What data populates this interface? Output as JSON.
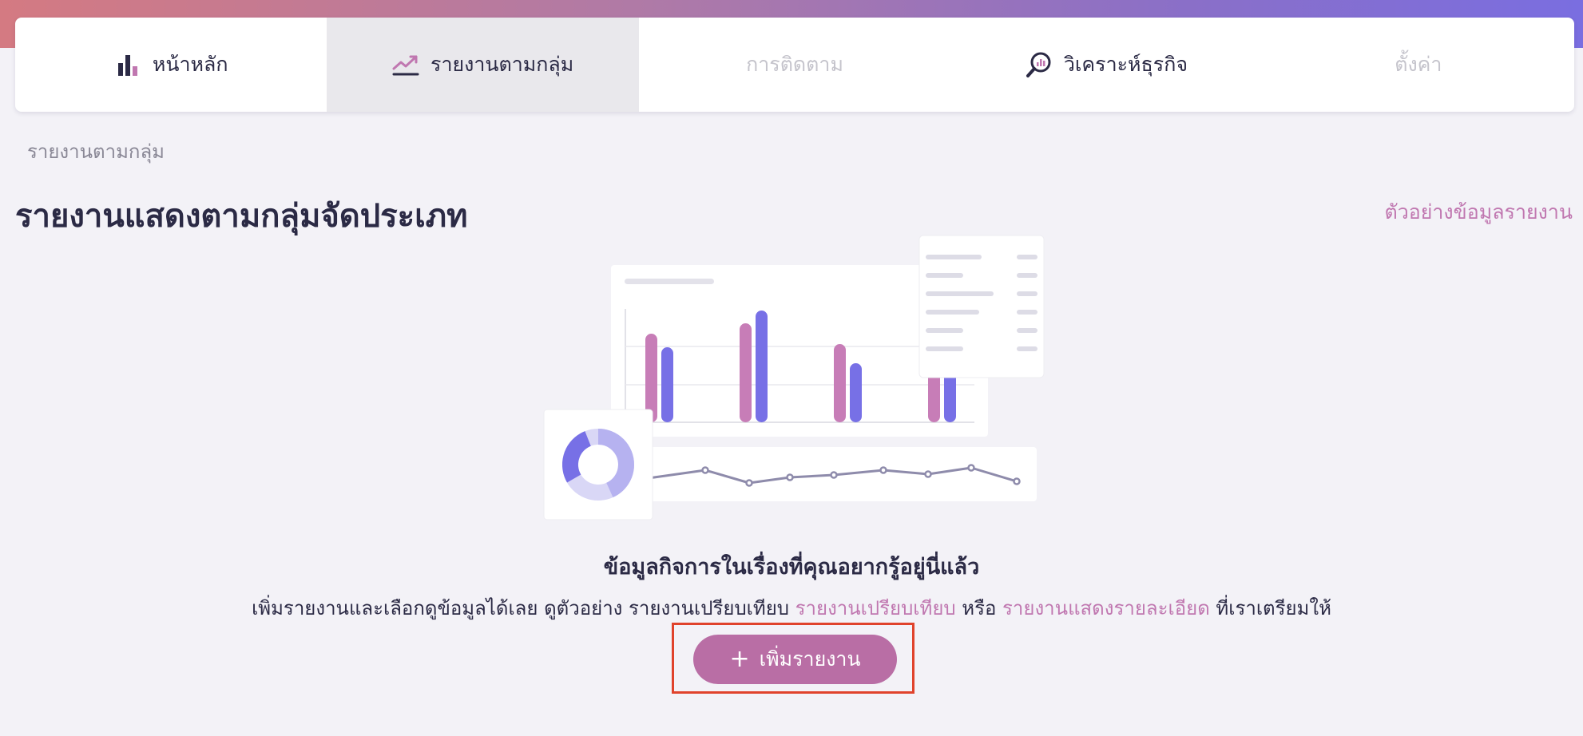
{
  "nav": {
    "items": [
      {
        "label": "หน้าหลัก",
        "icon": "bar-chart-icon"
      },
      {
        "label": "รายงานตามกลุ่ม",
        "icon": "trend-line-icon"
      },
      {
        "label": "การติดตาม",
        "icon": ""
      },
      {
        "label": "วิเคราะห์ธุรกิจ",
        "icon": "magnify-chart-icon"
      },
      {
        "label": "ตั้งค่า",
        "icon": ""
      }
    ]
  },
  "breadcrumb": "รายงานตามกลุ่ม",
  "page_title": "รายงานแสดงตามกลุ่มจัดประเภท",
  "example_link": "ตัวอย่างข้อมูลรายงาน",
  "empty_state": {
    "heading": "ข้อมูลกิจการในเรื่องที่คุณอยากรู้อยู่นี่แล้ว",
    "desc_prefix": "เพิ่มรายงานและเลือกดูข้อมูลได้เลย ดูตัวอย่าง รายงานเปรียบเทียบ",
    "link_compare": "รายงานเปรียบเทียบ",
    "desc_or": "หรือ",
    "link_detail": "รายงานแสดงรายละเอียด",
    "desc_suffix": "ที่เราเตรียมให้"
  },
  "add_button": {
    "icon": "plus-icon",
    "label": "เพิ่มรายงาน"
  },
  "colors": {
    "accent": "#b96ea5",
    "link": "#c077b0",
    "bar_blue": "#7770e6",
    "bar_pink": "#c77db7"
  }
}
